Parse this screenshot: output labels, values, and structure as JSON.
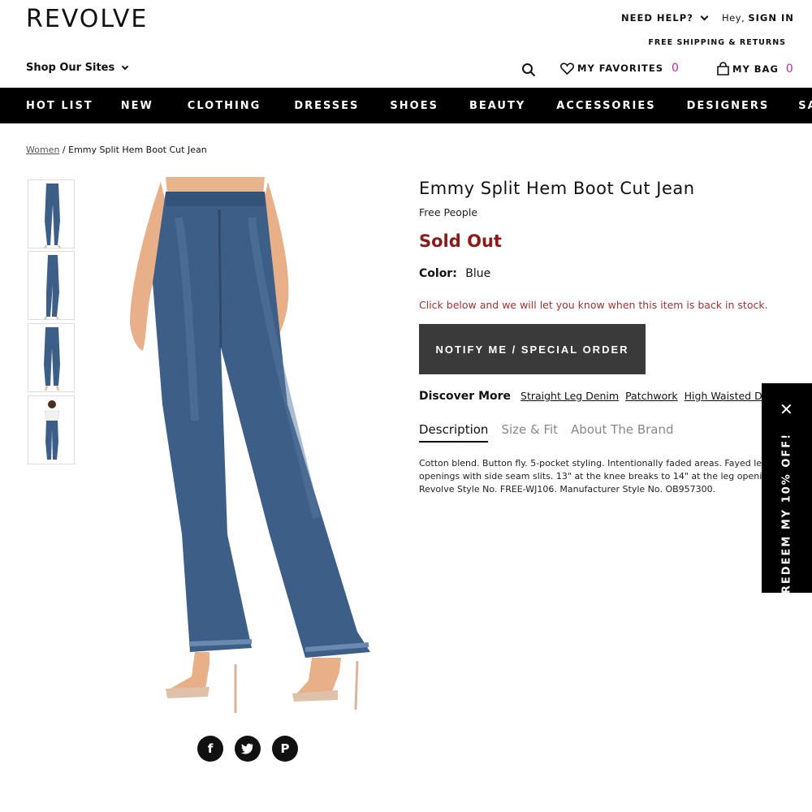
{
  "header": {
    "logo": "REVOLVE",
    "need_help": "NEED HELP?",
    "hey": "Hey,",
    "sign_in": "SIGN IN",
    "shipping": "FREE SHIPPING & RETURNS",
    "shop_sites": "Shop Our Sites",
    "favorites_label": "MY FAVORITES",
    "favorites_count": "0",
    "bag_label": "MY BAG",
    "bag_count": "0"
  },
  "nav": {
    "items": [
      "HOT LIST",
      "NEW",
      "CLOTHING",
      "DRESSES",
      "SHOES",
      "BEAUTY",
      "ACCESSORIES",
      "DESIGNERS",
      "SALE"
    ]
  },
  "breadcrumb": {
    "parent": "Women",
    "separator": "/",
    "current": "Emmy Split Hem Boot Cut Jean"
  },
  "product": {
    "title": "Emmy Split Hem Boot Cut Jean",
    "brand": "Free People",
    "status": "Sold Out",
    "color_label": "Color:",
    "color_value": "Blue",
    "notify_text": "Click below and we will let you know when this item is back in stock.",
    "notify_button": "NOTIFY ME / SPECIAL ORDER",
    "discover_title": "Discover More",
    "discover_links": [
      "Straight Leg Denim",
      "Patchwork",
      "High Waisted Denim"
    ],
    "tabs": [
      "Description",
      "Size & Fit",
      "About The Brand"
    ],
    "description_lines": [
      "Cotton blend. Button fly. 5-pocket styling. Intentionally faded areas. Fayed leg",
      "openings with side seam slits. 13\" at the knee breaks to 14\" at the leg opening.",
      "Revolve Style No. FREE-WJ106. Manufacturer Style No. OB957300."
    ]
  },
  "social": {
    "facebook": "f",
    "pinterest": "P"
  },
  "promo": {
    "text": "REDEEM MY 10% OFF!",
    "close": "✕"
  },
  "colors": {
    "sold_out": "#8b1a1a",
    "notify_text": "#a23232",
    "counts": "#c026a0",
    "denim": "#3d5e86",
    "nav_bg": "#000000",
    "button_bg": "#3a3a3a"
  }
}
